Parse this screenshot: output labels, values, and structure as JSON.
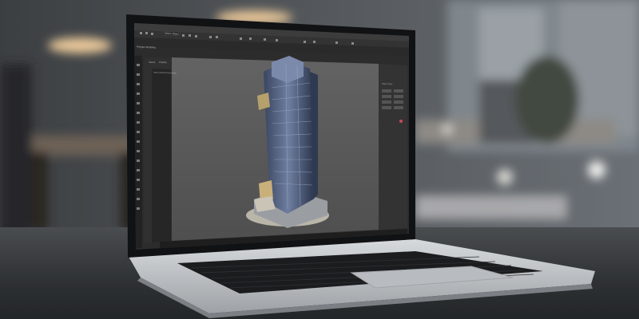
{
  "app": {
    "toolbar_search": "Select Object",
    "ribbon_label": "Polygon Modeling",
    "panel_tabs": [
      "Select",
      "Display"
    ],
    "scene_explorer_item": "Name (Sorted Ascending)",
    "command_panel_header": "Object Type"
  },
  "colors": {
    "viewport": "#5b5b5b",
    "ui_dark": "#2c2c2c",
    "ui_mid": "#3c3c3c",
    "bezel": "#111214",
    "aluminum": "#c9ccd0",
    "accent_selection": "#c9b07a"
  }
}
